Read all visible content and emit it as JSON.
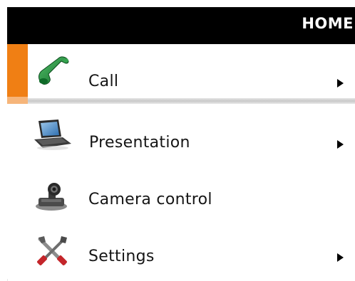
{
  "header": {
    "title": "HOME"
  },
  "menu": {
    "items": [
      {
        "label": "Call",
        "icon": "phone-icon",
        "has_submenu": true,
        "selected": true
      },
      {
        "label": "Presentation",
        "icon": "laptop-icon",
        "has_submenu": true,
        "selected": false
      },
      {
        "label": "Camera control",
        "icon": "camera-icon",
        "has_submenu": false,
        "selected": false
      },
      {
        "label": "Settings",
        "icon": "tools-icon",
        "has_submenu": true,
        "selected": false
      }
    ]
  },
  "colors": {
    "header_bg": "#000000",
    "header_text": "#ffffff",
    "selection_accent": "#f07f14",
    "selection_accent_light": "#f6b57a",
    "phone_green": "#1f8a3a"
  }
}
